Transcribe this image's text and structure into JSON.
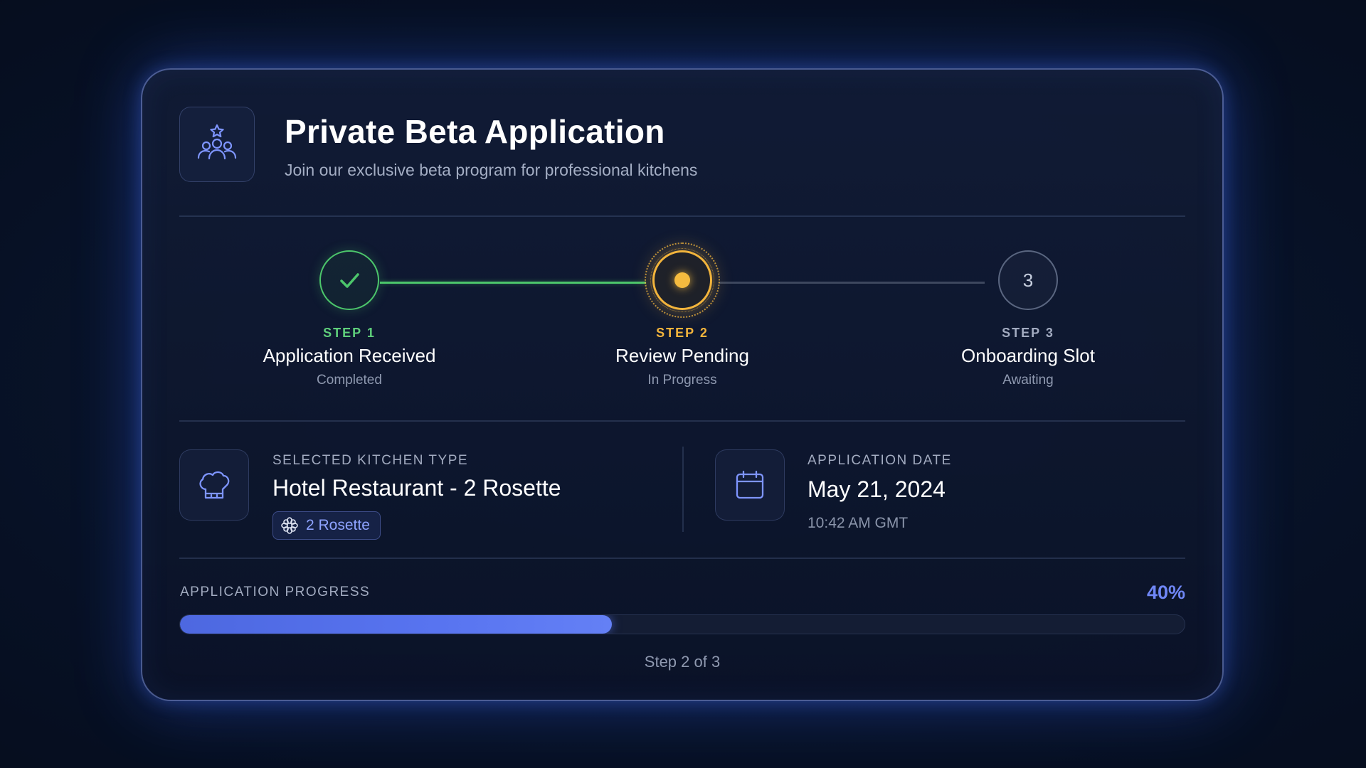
{
  "header": {
    "icon": "users-star-icon",
    "title": "Private Beta Application",
    "subtitle": "Join our exclusive beta program for professional kitchens"
  },
  "steps": [
    {
      "kicker": "STEP 1",
      "title": "Application Received",
      "status": "Completed",
      "state": "done",
      "icon": "check-icon"
    },
    {
      "kicker": "STEP 2",
      "title": "Review Pending",
      "status": "In Progress",
      "state": "active"
    },
    {
      "kicker": "STEP 3",
      "title": "Onboarding Slot",
      "status": "Awaiting",
      "state": "pending",
      "number": "3"
    }
  ],
  "kitchen": {
    "icon": "chef-hat-icon",
    "label": "SELECTED KITCHEN TYPE",
    "value": "Hotel Restaurant - 2 Rosette",
    "badge_icon": "rosette-icon",
    "badge": "2 Rosette"
  },
  "date": {
    "icon": "calendar-icon",
    "label": "APPLICATION DATE",
    "value": "May 21, 2024",
    "time": "10:42 AM GMT"
  },
  "progress": {
    "label": "APPLICATION PROGRESS",
    "percent_text": "40%",
    "fraction": 0.43,
    "step_text": "Step 2 of 3"
  },
  "colors": {
    "accent": "#6f86f5",
    "done": "#4cc66b",
    "active": "#f2b43c",
    "pending": "#5a6680"
  }
}
